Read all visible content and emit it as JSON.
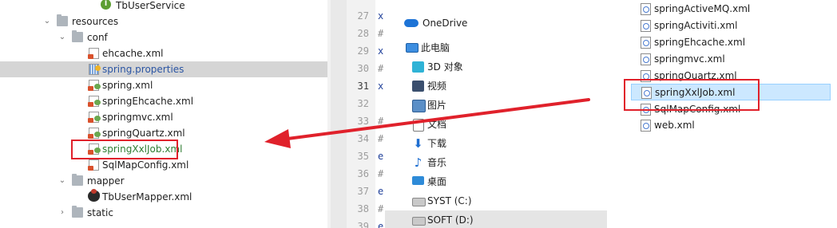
{
  "project_tree": {
    "items": [
      {
        "label": "TbUserService",
        "icon": "interface-icon",
        "color": "#1e1e1e"
      },
      {
        "label": "resources",
        "icon": "folder-icon",
        "color": "#1e1e1e"
      },
      {
        "label": "conf",
        "icon": "folder-icon",
        "color": "#1e1e1e"
      },
      {
        "label": "ehcache.xml",
        "icon": "xml-file-icon",
        "color": "#1e1e1e"
      },
      {
        "label": "spring.properties",
        "icon": "properties-file-icon",
        "color": "#2b55a3"
      },
      {
        "label": "spring.xml",
        "icon": "spring-xml-file-icon",
        "color": "#1e1e1e"
      },
      {
        "label": "springEhcache.xml",
        "icon": "spring-xml-file-icon",
        "color": "#1e1e1e"
      },
      {
        "label": "springmvc.xml",
        "icon": "spring-xml-file-icon",
        "color": "#1e1e1e"
      },
      {
        "label": "springQuartz.xml",
        "icon": "spring-xml-file-icon",
        "color": "#1e1e1e"
      },
      {
        "label": "springXxlJob.xml",
        "icon": "spring-xml-file-icon",
        "color": "#2e7d32"
      },
      {
        "label": "SqlMapConfig.xml",
        "icon": "xml-file-icon",
        "color": "#1e1e1e"
      },
      {
        "label": "mapper",
        "icon": "folder-icon",
        "color": "#1e1e1e"
      },
      {
        "label": "TbUserMapper.xml",
        "icon": "mybatis-mapper-icon",
        "color": "#1e1e1e"
      },
      {
        "label": "static",
        "icon": "folder-icon",
        "color": "#1e1e1e"
      }
    ]
  },
  "editor": {
    "line_numbers": [
      "27",
      "28",
      "29",
      "30",
      "31",
      "32",
      "33",
      "34",
      "35",
      "36",
      "37",
      "38",
      "39"
    ],
    "line_chars": [
      "x",
      "#",
      "x",
      "#",
      "x",
      "",
      "#",
      "#",
      "e",
      "#",
      "e",
      "#",
      "e"
    ],
    "current_line": "31"
  },
  "explorer_nav": {
    "items": [
      {
        "label": "OneDrive",
        "icon": "onedrive-icon"
      },
      {
        "label": "此电脑",
        "icon": "this-pc-icon"
      },
      {
        "label": "3D 对象",
        "icon": "3d-objects-icon"
      },
      {
        "label": "视频",
        "icon": "videos-icon"
      },
      {
        "label": "图片",
        "icon": "pictures-icon"
      },
      {
        "label": "文档",
        "icon": "documents-icon"
      },
      {
        "label": "下载",
        "icon": "downloads-icon"
      },
      {
        "label": "音乐",
        "icon": "music-icon"
      },
      {
        "label": "桌面",
        "icon": "desktop-icon"
      },
      {
        "label": "SYST (C:)",
        "icon": "drive-icon"
      },
      {
        "label": "SOFT (D:)",
        "icon": "drive-icon"
      }
    ],
    "selected": "SOFT (D:)"
  },
  "explorer_files": {
    "items": [
      "springActiveMQ.xml",
      "springActiviti.xml",
      "springEhcache.xml",
      "springmvc.xml",
      "springQuartz.xml",
      "springXxlJob.xml",
      "SqlMapConfig.xml",
      "web.xml"
    ],
    "selected": "springXxlJob.xml"
  },
  "colors": {
    "highlight_box": "#e0212b",
    "arrow": "#e0212b",
    "selected_file_bg": "#cce8ff",
    "tree_selected_bg": "#d5d5d5"
  }
}
